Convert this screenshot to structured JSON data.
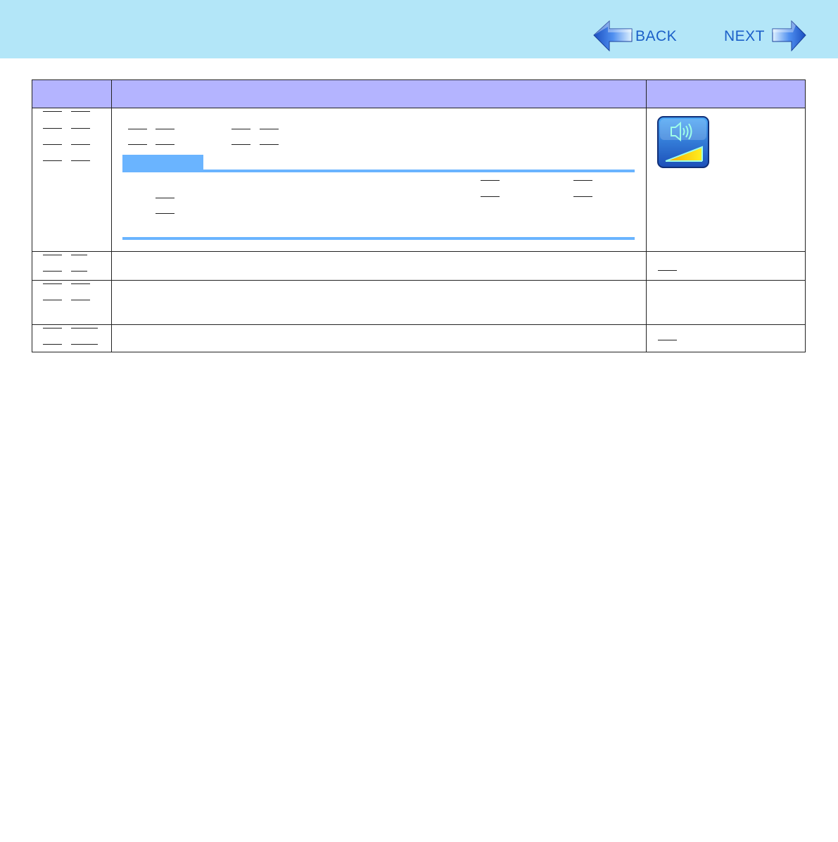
{
  "nav": {
    "back_label": "BACK",
    "next_label": "NEXT"
  },
  "colors": {
    "header_bg": "#b3e6f8",
    "table_header_bg": "#b4b4ff",
    "note_accent": "#6ab4ff",
    "nav_text": "#1b5fc8"
  },
  "icons": {
    "back": "back-arrow-icon",
    "next": "next-arrow-icon",
    "volume": "speaker-volume-icon"
  }
}
